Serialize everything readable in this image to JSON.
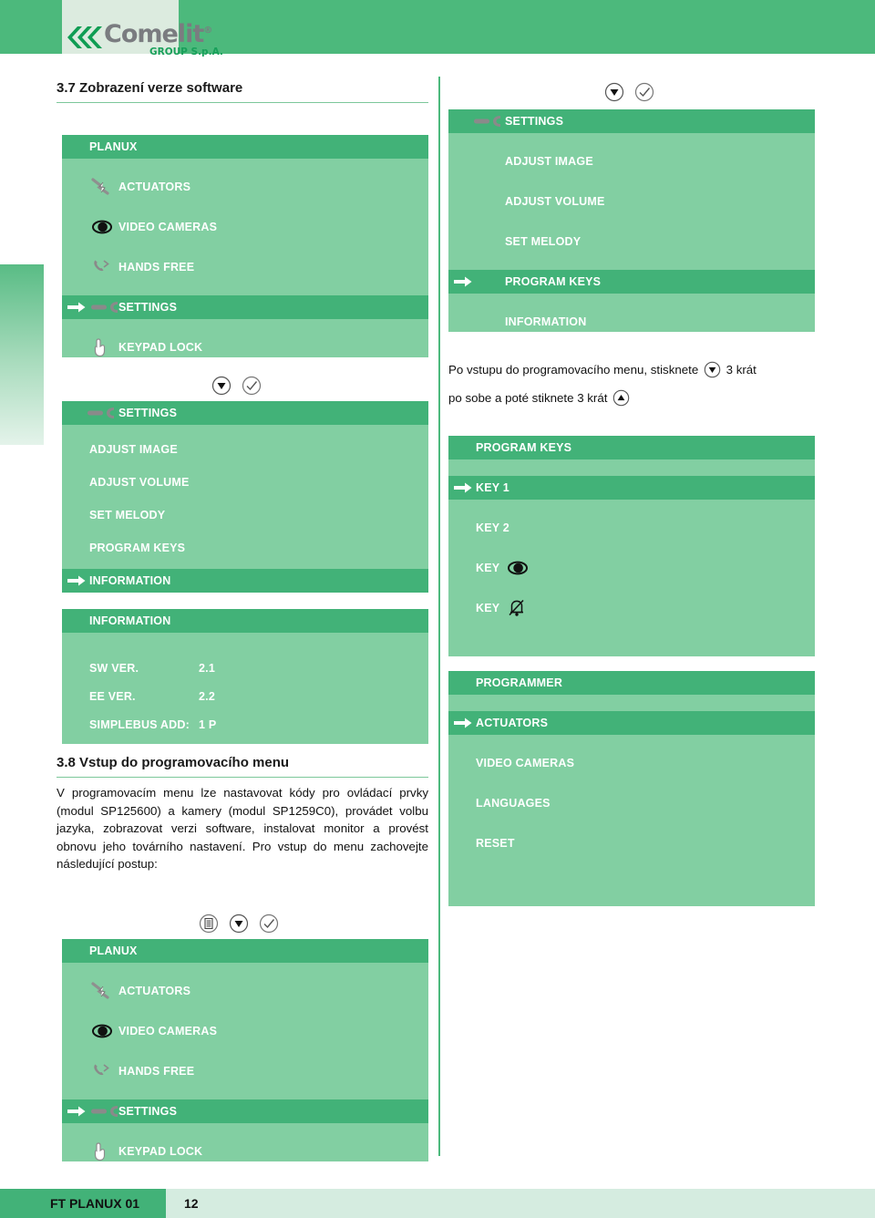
{
  "brand": {
    "name": "Comelit",
    "registered": "®",
    "subtitle": "GROUP S.p.A.",
    "logo_icon": "comelit-logo-icon",
    "accent_green": "#42b278",
    "panel_green": "#82cfa2",
    "header_green": "#4cb97c",
    "footer_green": "#d5ece0"
  },
  "sections": {
    "s37": {
      "title": "3.7 Zobrazení verze software"
    },
    "s38": {
      "title": "3.8 Vstup do programovacího menu",
      "body": "V programovacím menu lze nastavovat kódy pro ovládací prvky (modul SP125600) a kamery (modul SP1259C0), provádet volbu jazyka, zobrazovat verzi software, instalovat monitor a provést obnovu jeho továrního nastavení. Pro vstup do menu zachovejte následující postup:"
    }
  },
  "note": {
    "line1_a": "Po vstupu do programovacího menu, stisknete",
    "line1_b": "3 krát",
    "line2_a": "po sobe a poté stiknete 3 krát",
    "down_icon": "arrow-down-button-icon",
    "up_icon": "arrow-up-button-icon"
  },
  "panels": {
    "planux_top": {
      "header": "PLANUX",
      "rows": [
        {
          "label": "ACTUATORS",
          "icon": "lightning-icon",
          "selected": false,
          "arrow": false
        },
        {
          "label": "VIDEO CAMERAS",
          "icon": "eye-icon",
          "selected": false,
          "arrow": false
        },
        {
          "label": "HANDS FREE",
          "icon": "handset-icon",
          "selected": false,
          "arrow": false
        },
        {
          "label": "SETTINGS",
          "icon": "wrench-icon",
          "selected": true,
          "arrow": true
        },
        {
          "label": "KEYPAD LOCK",
          "icon": "hand-icon",
          "selected": false,
          "arrow": false
        }
      ]
    },
    "settings_left": {
      "header": "SETTINGS",
      "header_icon": "wrench-icon",
      "rows": [
        {
          "label": "ADJUST IMAGE",
          "icon": "",
          "selected": false,
          "arrow": false
        },
        {
          "label": "ADJUST VOLUME",
          "icon": "",
          "selected": false,
          "arrow": false
        },
        {
          "label": "SET MELODY",
          "icon": "",
          "selected": false,
          "arrow": false
        },
        {
          "label": "PROGRAM KEYS",
          "icon": "",
          "selected": false,
          "arrow": false
        },
        {
          "label": "INFORMATION",
          "icon": "",
          "selected": true,
          "arrow": true
        }
      ]
    },
    "settings_right": {
      "header": "SETTINGS",
      "header_icon": "wrench-icon",
      "rows": [
        {
          "label": "ADJUST IMAGE",
          "icon": "",
          "selected": false,
          "arrow": false
        },
        {
          "label": "ADJUST VOLUME",
          "icon": "",
          "selected": false,
          "arrow": false
        },
        {
          "label": "SET MELODY",
          "icon": "",
          "selected": false,
          "arrow": false
        },
        {
          "label": "PROGRAM KEYS",
          "icon": "",
          "selected": true,
          "arrow": true
        },
        {
          "label": "INFORMATION",
          "icon": "",
          "selected": false,
          "arrow": false
        }
      ]
    },
    "information": {
      "header": "INFORMATION",
      "fields": [
        {
          "label": "SW VER.",
          "value": "2.1"
        },
        {
          "label": "EE VER.",
          "value": "2.2"
        },
        {
          "label": "SIMPLEBUS ADD:",
          "value": "1 P"
        }
      ]
    },
    "program_keys": {
      "header": "PROGRAM KEYS",
      "rows": [
        {
          "label": "KEY 1",
          "icon": "",
          "selected": true,
          "arrow": true
        },
        {
          "label": "KEY 2",
          "icon": "",
          "selected": false,
          "arrow": false
        },
        {
          "label": "KEY",
          "icon": "eye-icon",
          "selected": false,
          "arrow": false
        },
        {
          "label": "KEY",
          "icon": "bell-muted-icon",
          "selected": false,
          "arrow": false
        }
      ]
    },
    "programmer": {
      "header": "PROGRAMMER",
      "rows": [
        {
          "label": "ACTUATORS",
          "icon": "",
          "selected": true,
          "arrow": true
        },
        {
          "label": "VIDEO CAMERAS",
          "icon": "",
          "selected": false,
          "arrow": false
        },
        {
          "label": "LANGUAGES",
          "icon": "",
          "selected": false,
          "arrow": false
        },
        {
          "label": "RESET",
          "icon": "",
          "selected": false,
          "arrow": false
        }
      ]
    },
    "planux_bottom": {
      "header": "PLANUX",
      "rows": [
        {
          "label": "ACTUATORS",
          "icon": "lightning-icon",
          "selected": false,
          "arrow": false
        },
        {
          "label": "VIDEO CAMERAS",
          "icon": "eye-icon",
          "selected": false,
          "arrow": false
        },
        {
          "label": "HANDS FREE",
          "icon": "handset-icon",
          "selected": false,
          "arrow": false
        },
        {
          "label": "SETTINGS",
          "icon": "wrench-icon",
          "selected": true,
          "arrow": true
        },
        {
          "label": "KEYPAD LOCK",
          "icon": "hand-icon",
          "selected": false,
          "arrow": false
        }
      ]
    }
  },
  "button_rows": {
    "top_right": [
      "arrow-down-button-icon",
      "check-button-icon"
    ],
    "mid_left": [
      "arrow-down-button-icon",
      "check-button-icon"
    ],
    "bottom_left": [
      "menu-button-icon",
      "arrow-down-button-icon",
      "check-button-icon"
    ]
  },
  "footer": {
    "doc_code": "FT PLANUX 01",
    "page_number": "12"
  }
}
